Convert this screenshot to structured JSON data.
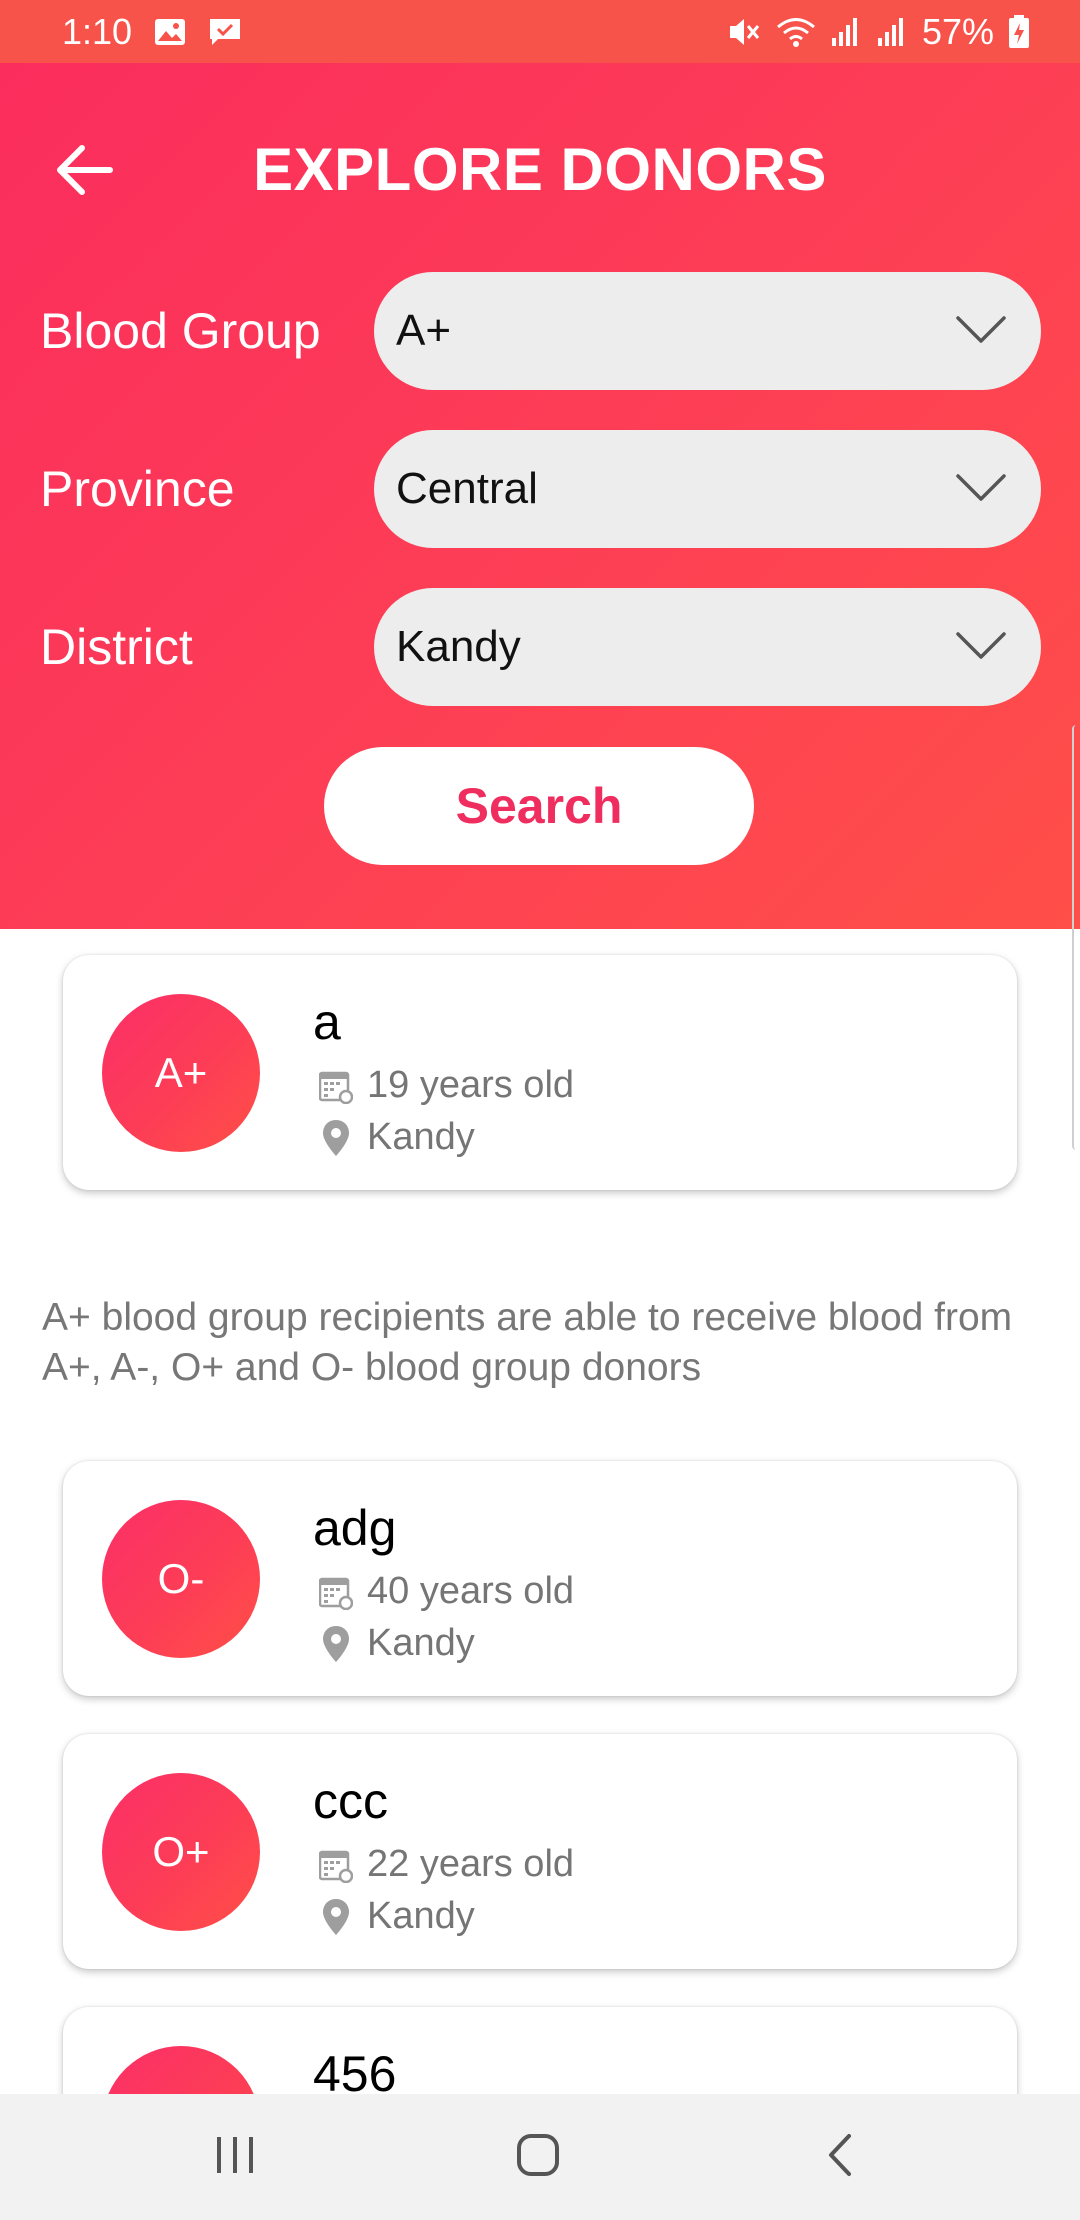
{
  "status_bar": {
    "time": "1:10",
    "battery_percent": "57%",
    "left_icons": [
      "image-icon",
      "message-icon"
    ],
    "right_icons": [
      "mute-icon",
      "wifi-icon",
      "signal-icon",
      "signal-icon",
      "battery-icon"
    ]
  },
  "header": {
    "title": "EXPLORE DONORS",
    "back_icon": "arrow-left-icon"
  },
  "filters": {
    "blood_group": {
      "label": "Blood Group",
      "value": "A+"
    },
    "province": {
      "label": "Province",
      "value": "Central"
    },
    "district": {
      "label": "District",
      "value": "Kandy"
    }
  },
  "search_button": {
    "label": "Search"
  },
  "donors": [
    {
      "name": "a",
      "blood_group": "A+",
      "age": "19 years old",
      "location": "Kandy"
    },
    {
      "name": "adg",
      "blood_group": "O-",
      "age": "40 years old",
      "location": "Kandy"
    },
    {
      "name": "ccc",
      "blood_group": "O+",
      "age": "22 years old",
      "location": "Kandy"
    },
    {
      "name": "456",
      "blood_group": "",
      "age": "",
      "location": ""
    }
  ],
  "info_text": "A+ blood group recipients are able to receive blood from A+, A-, O+ and O- blood group donors",
  "colors": {
    "primary": "#fd3d56",
    "gradient_start": "#fb2d5d",
    "gradient_end": "#ff4f48",
    "status_bar": "#f7534a",
    "accent_text": "#ef2d5e"
  },
  "nav_bar": {
    "icons": [
      "recent-apps-icon",
      "home-icon",
      "back-icon"
    ]
  }
}
